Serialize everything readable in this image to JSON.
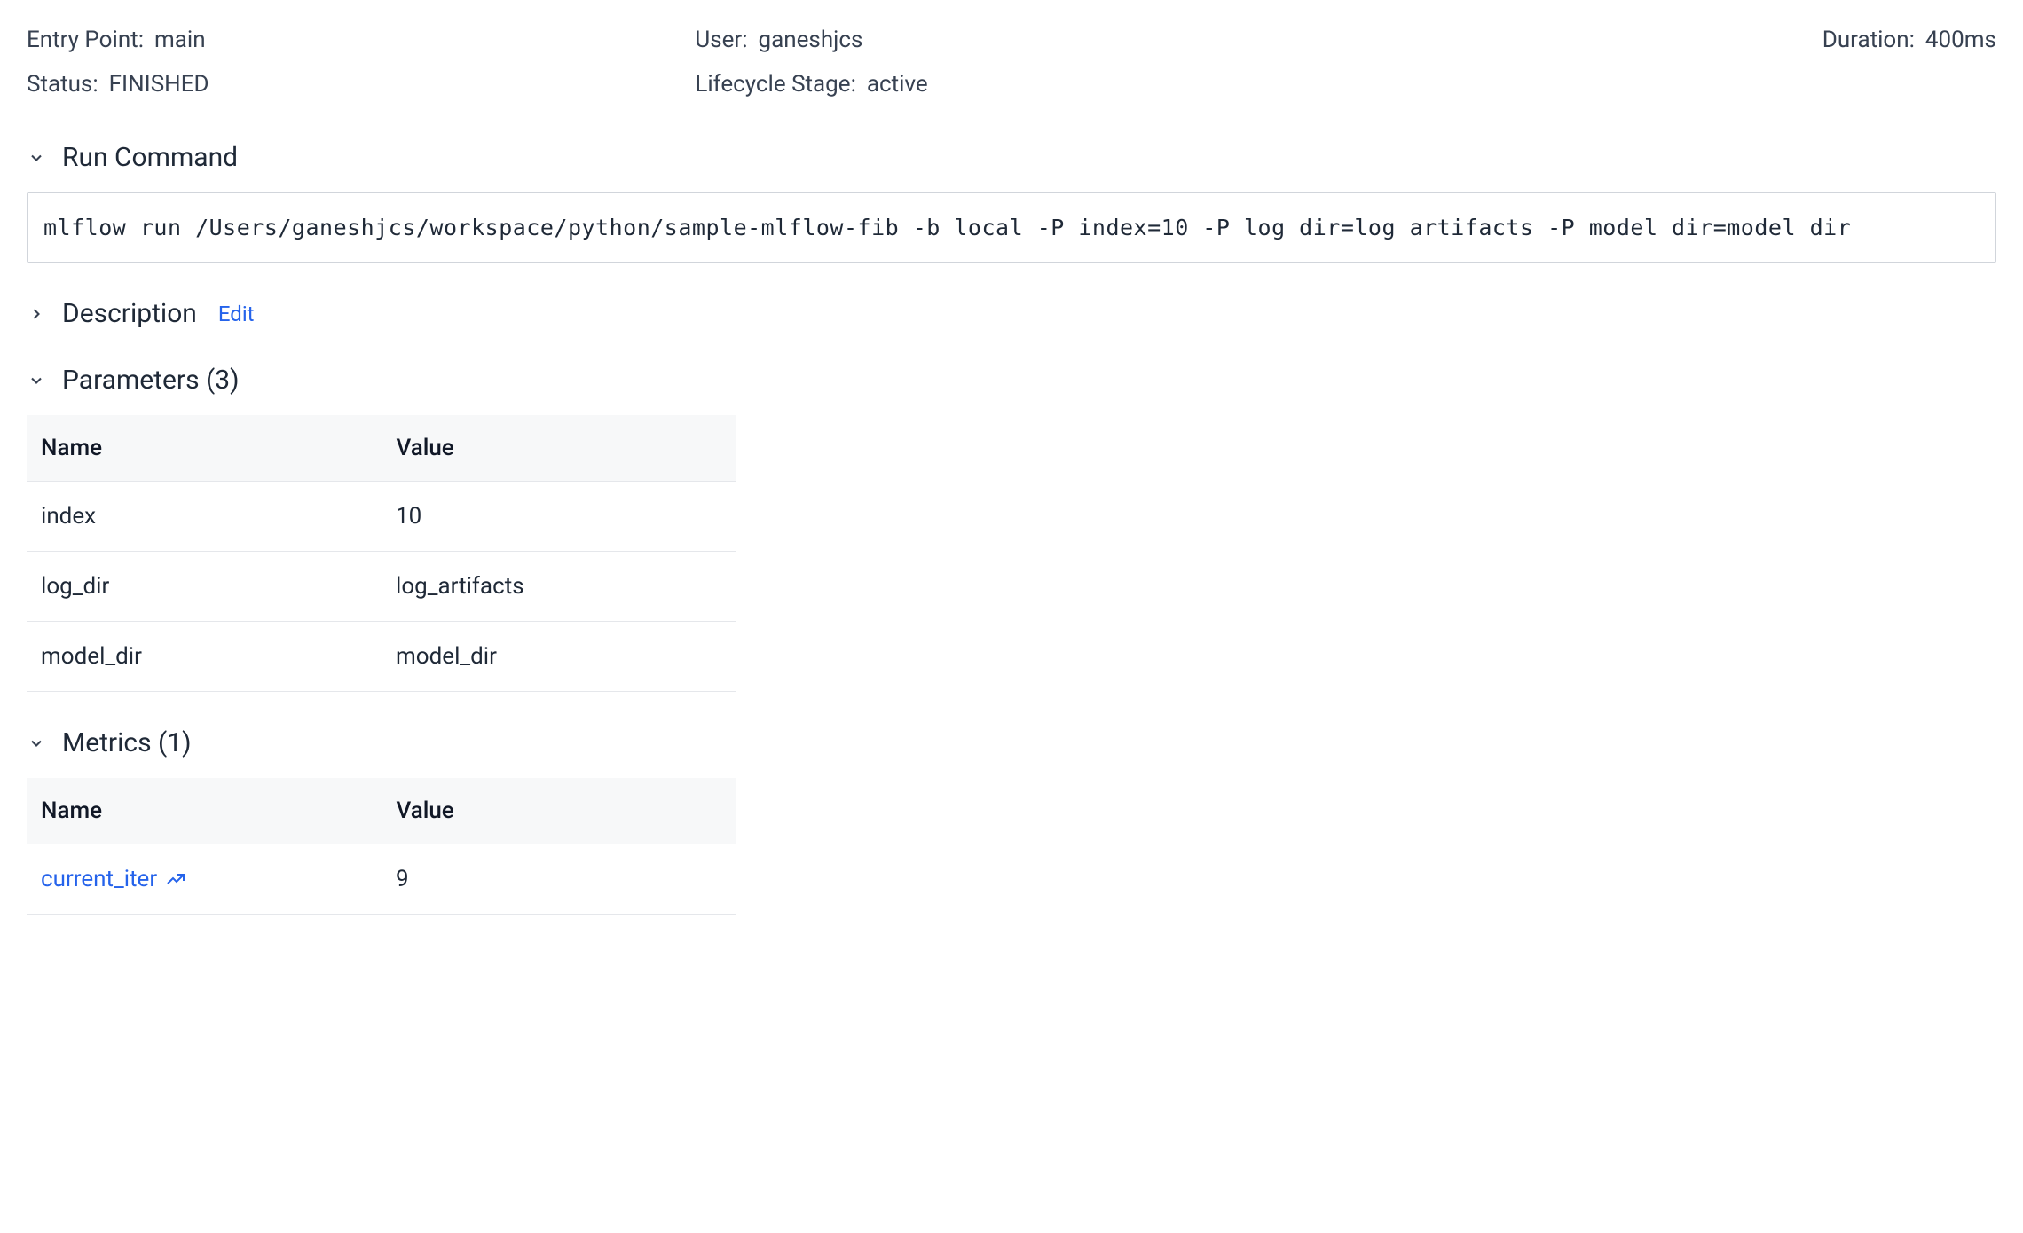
{
  "info": {
    "entry_point_label": "Entry Point",
    "entry_point_value": "main",
    "user_label": "User",
    "user_value": "ganeshjcs",
    "duration_label": "Duration",
    "duration_value": "400ms",
    "status_label": "Status",
    "status_value": "FINISHED",
    "lifecycle_label": "Lifecycle Stage",
    "lifecycle_value": "active"
  },
  "sections": {
    "run_command": {
      "title": "Run Command",
      "command": "mlflow run /Users/ganeshjcs/workspace/python/sample-mlflow-fib -b local -P index=10 -P log_dir=log_artifacts -P model_dir=model_dir"
    },
    "description": {
      "title": "Description",
      "edit_label": "Edit"
    },
    "parameters": {
      "title": "Parameters (3)",
      "headers": {
        "name": "Name",
        "value": "Value"
      },
      "rows": [
        {
          "name": "index",
          "value": "10"
        },
        {
          "name": "log_dir",
          "value": "log_artifacts"
        },
        {
          "name": "model_dir",
          "value": "model_dir"
        }
      ]
    },
    "metrics": {
      "title": "Metrics (1)",
      "headers": {
        "name": "Name",
        "value": "Value"
      },
      "rows": [
        {
          "name": "current_iter",
          "value": "9"
        }
      ]
    }
  }
}
